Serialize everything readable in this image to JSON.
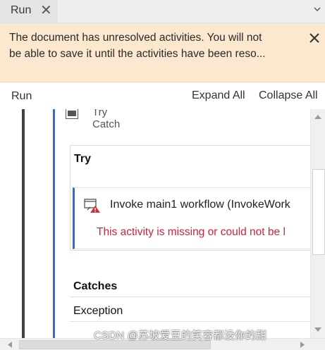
{
  "tab": {
    "label": "Run",
    "close_glyph": "✕"
  },
  "banner": {
    "line1": "The document has unresolved activities. You will not",
    "line2": "be able to save it until the activities have been reso..."
  },
  "toolbar": {
    "run_label": "Run",
    "expand_all_label": "Expand All",
    "collapse_all_label": "Collapse All"
  },
  "designer": {
    "try_catch": {
      "title": "Try Catch",
      "try_label": "Try",
      "invoke": {
        "title": "Invoke main1 workflow (InvokeWork",
        "error": "This activity is missing or could not be l"
      },
      "catches_label": "Catches",
      "exception_label": "Exception"
    }
  },
  "watermark": "CSDN @苏坡爱豆的笑容都没你的甜",
  "colors": {
    "accent_blue": "#2b6fd6",
    "error_red": "#d2213a",
    "banner_bg": "#fce8cf"
  }
}
